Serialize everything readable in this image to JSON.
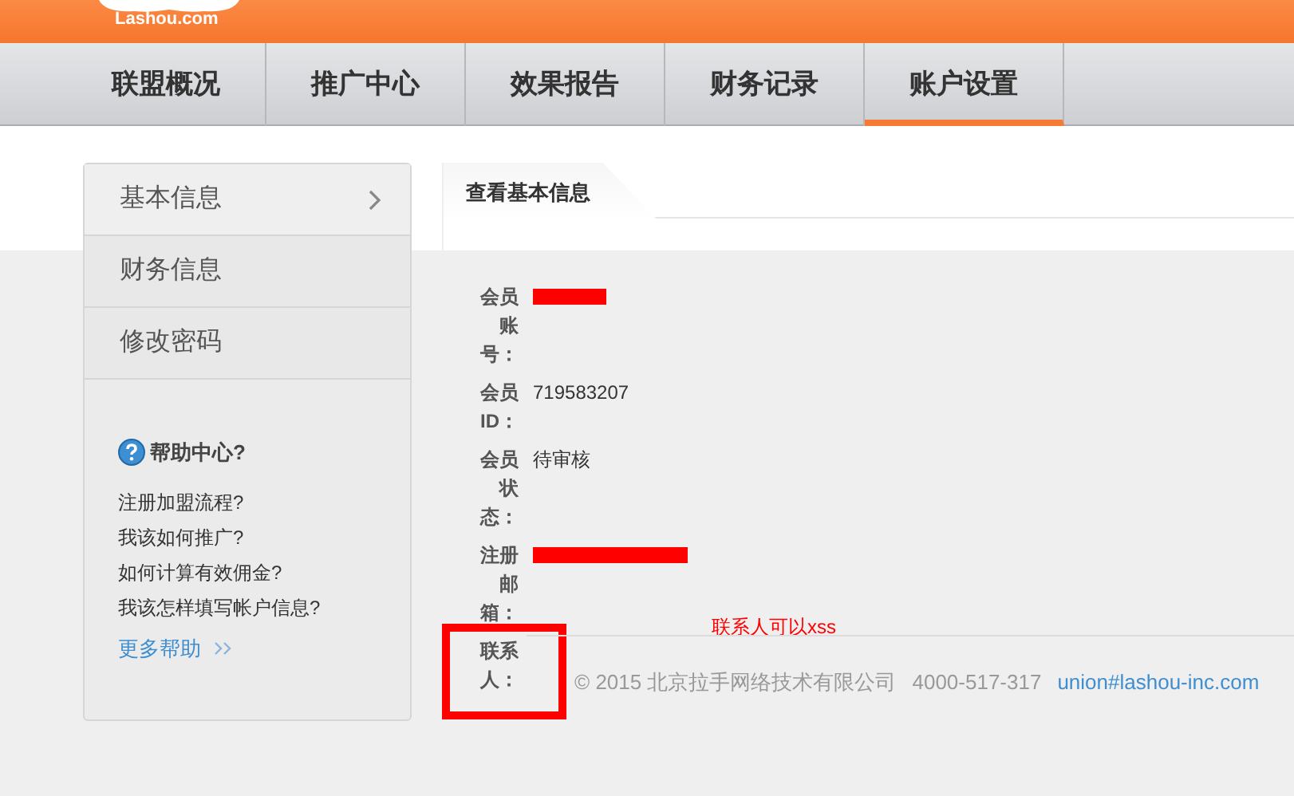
{
  "header": {
    "logo": "Lashou.com"
  },
  "nav": [
    {
      "label": "联盟概况",
      "selected": false
    },
    {
      "label": "推广中心",
      "selected": false
    },
    {
      "label": "效果报告",
      "selected": false
    },
    {
      "label": "财务记录",
      "selected": false
    },
    {
      "label": "账户设置",
      "selected": true
    }
  ],
  "sidebar": {
    "items": [
      {
        "label": "基本信息",
        "selected": true
      },
      {
        "label": "财务信息",
        "selected": false
      },
      {
        "label": "修改密码",
        "selected": false
      }
    ],
    "help": {
      "title": "帮助中心?",
      "links": [
        "注册加盟流程?",
        "我该如何推广?",
        "如何计算有效佣金?",
        "我该怎样填写帐户信息?"
      ],
      "more": "更多帮助"
    }
  },
  "content": {
    "tab": "查看基本信息",
    "fields": [
      {
        "label": "会员账号：",
        "redacted": true,
        "highlighted": false
      },
      {
        "label": "会员ID：",
        "value": "719583207",
        "redacted": false,
        "highlighted": false
      },
      {
        "label": "会员状态：",
        "value": "待审核",
        "redacted": false,
        "highlighted": false
      },
      {
        "label": "注册邮箱：",
        "redacted": true,
        "highlighted": false
      },
      {
        "label": "联系人：",
        "redacted": false,
        "highlighted": true
      }
    ],
    "note": "联系人可以xss"
  },
  "footer": {
    "copyright": "© 2015 北京拉手网络技术有限公司",
    "phone": "4000-517-317",
    "email": "union#lashou-inc.com"
  }
}
